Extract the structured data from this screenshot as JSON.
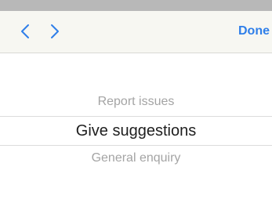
{
  "toolbar": {
    "prev_icon": "chevron-left-icon",
    "next_icon": "chevron-right-icon",
    "done_label": "Done",
    "accent_color": "#2f7fe9"
  },
  "picker": {
    "options": [
      "Report issues",
      "Give suggestions",
      "General enquiry"
    ],
    "selected": "Give suggestions"
  }
}
